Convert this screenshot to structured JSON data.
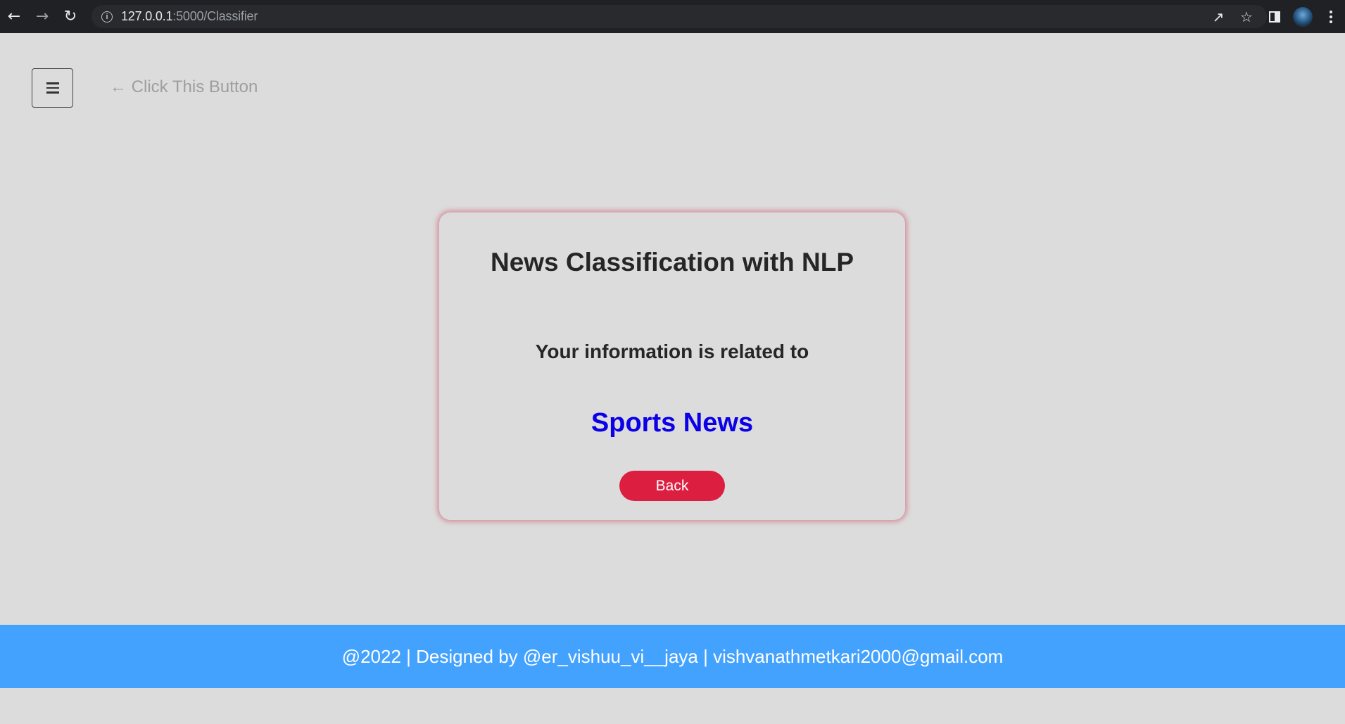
{
  "browser": {
    "url_host": "127.0.0.1",
    "url_path": ":5000/Classifier",
    "icons": [
      "back-arrow-icon",
      "forward-arrow-icon",
      "reload-icon",
      "info-icon",
      "share-icon",
      "star-icon",
      "side-panel-icon",
      "profile-avatar",
      "kebab-menu-icon"
    ]
  },
  "header": {
    "hint": "← Click This Button"
  },
  "card": {
    "title": "News Classification with NLP",
    "subtitle": "Your information is related to",
    "result": "Sports News",
    "back_label": "Back"
  },
  "footer": {
    "text": "@2022 | Designed by @er_vishuu_vi__jaya | vishvanathmetkari2000@gmail.com"
  },
  "colors": {
    "page_bg": "#dcdcdc",
    "result": "#0b00e6",
    "back_button": "#dc1e40",
    "footer_bg": "#44a2ff",
    "card_glow": "#ce5a6e"
  }
}
